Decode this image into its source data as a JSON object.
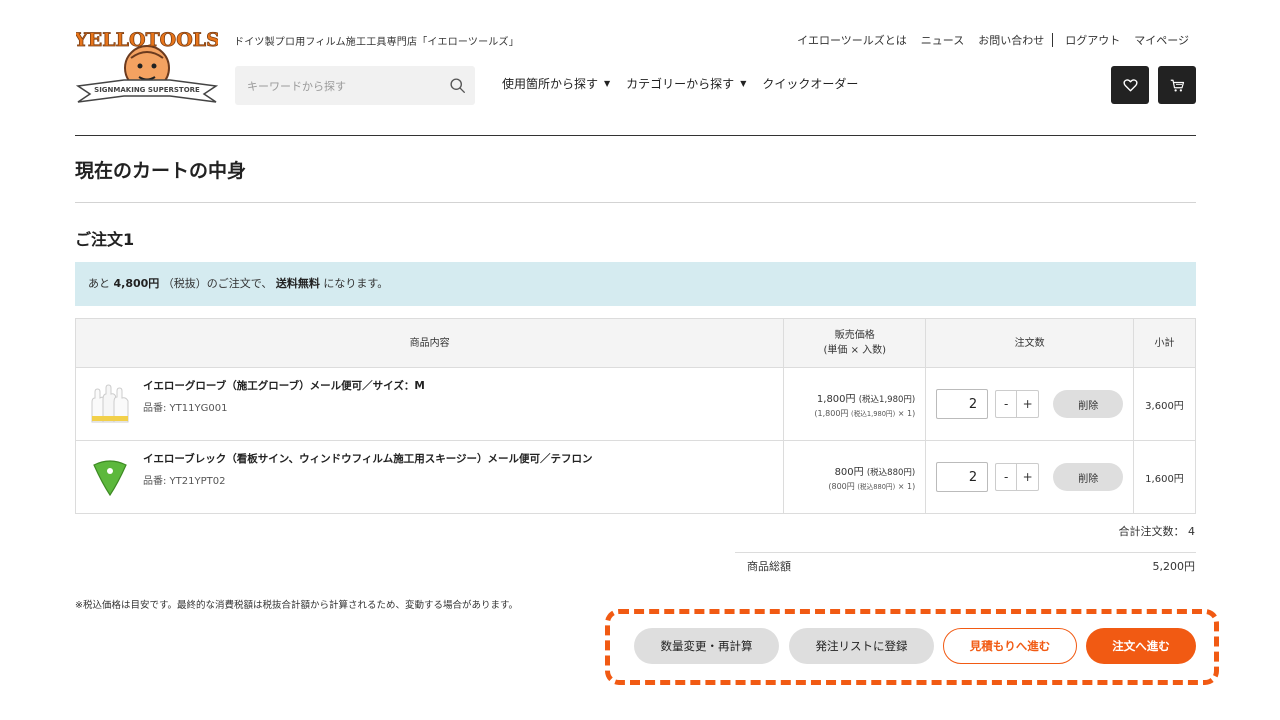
{
  "header": {
    "logo_text": "YELLOTOOLS",
    "logo_banner": "SIGNMAKING SUPERSTORE",
    "tagline": "ドイツ製プロ用フィルム施工工具専門店「イエローツールズ」",
    "search_placeholder": "キーワードから探す",
    "nav": [
      {
        "label": "使用箇所から探す",
        "caret": "▼"
      },
      {
        "label": "カテゴリーから探す",
        "caret": "▼"
      },
      {
        "label": "クイックオーダー"
      }
    ],
    "top_links": {
      "about": "イエローツールズとは",
      "news": "ニュース",
      "contact": "お問い合わせ",
      "logout": "ログアウト",
      "mypage": "マイページ"
    },
    "icons": {
      "favorite": "heart-icon",
      "cart": "cart-icon",
      "search": "search-icon"
    }
  },
  "page": {
    "title": "現在のカートの中身",
    "order_title": "ご注文1"
  },
  "notice": {
    "prefix": "あと",
    "amount": "4,800円",
    "mid": "（税抜）のご注文で、",
    "emphasis": "送料無料",
    "suffix": "になります。"
  },
  "table": {
    "headers": {
      "product": "商品内容",
      "price_line1": "販売価格",
      "price_line2": "(単価 × 入数)",
      "qty": "注文数",
      "subtotal": "小計"
    },
    "rows": [
      {
        "name": "イエローグローブ（施工グローブ）メール便可／サイズ：M",
        "code": "品番: YT11YG001",
        "price": "1,800円",
        "price_tax": "(税込1,980円)",
        "price_sub": "(1,800円",
        "price_sub_tax": "(税込1,980円)",
        "price_sub_mult": "× 1)",
        "qty": "2",
        "minus": "-",
        "plus": "+",
        "delete": "削除",
        "subtotal": "3,600円",
        "image_icon": "gloves-icon"
      },
      {
        "name": "イエローブレック（看板サイン、ウィンドウフィルム施工用スキージー）メール便可／テフロン",
        "code": "品番: YT21YPT02",
        "price": "800円",
        "price_tax": "(税込880円)",
        "price_sub": "(800円",
        "price_sub_tax": "(税込880円)",
        "price_sub_mult": "× 1)",
        "qty": "2",
        "minus": "-",
        "plus": "+",
        "delete": "削除",
        "subtotal": "1,600円",
        "image_icon": "squeegee-icon"
      }
    ]
  },
  "totals": {
    "count_label": "合計注文数：",
    "count": "4",
    "total_label": "商品総額",
    "total_value": "5,200円"
  },
  "tax_note": "※税込価格は目安です。最終的な消費税額は税抜合計額から計算されるため、変動する場合があります。",
  "actions": {
    "recalc": "数量変更・再計算",
    "order_list": "発注リストに登録",
    "quote": "見積もりへ進む",
    "checkout": "注文へ進む"
  },
  "colors": {
    "accent": "#f15a13",
    "notice_bg": "#d5ebf0",
    "icon_button_bg": "#222222",
    "gray_button_bg": "#dedede"
  }
}
